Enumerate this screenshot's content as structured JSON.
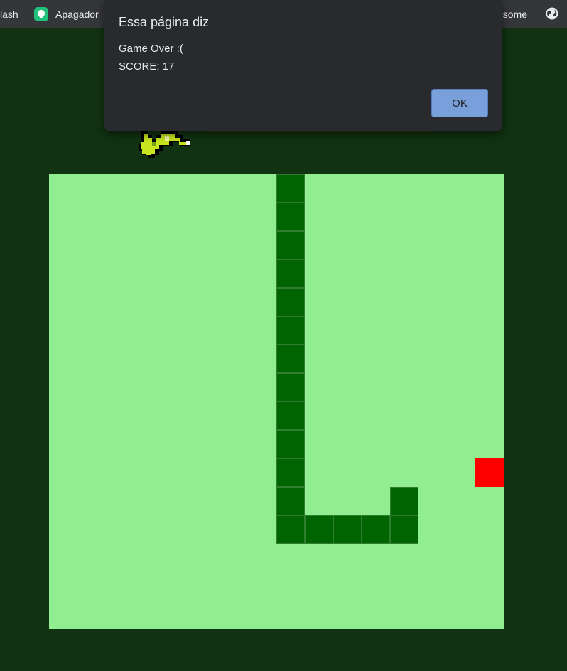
{
  "bookmarks": [
    {
      "label": "lash",
      "icon": "bookmark-icon"
    },
    {
      "label": "Apagador",
      "icon": "apagador-icon"
    },
    {
      "label": "esome",
      "icon": "bookmark-icon"
    },
    {
      "label": "",
      "icon": "globe-icon"
    }
  ],
  "dialog": {
    "title": "Essa página diz",
    "message_line1": "Game Over :(",
    "message_line2": "SCORE: 17",
    "ok_label": "OK"
  },
  "game": {
    "grid_columns": 16,
    "grid_rows": 16,
    "board_color": "#90ee90",
    "snake_color": "#006400",
    "food_color": "#ff0000",
    "background_color": "#113311",
    "snake": [
      [
        8,
        0
      ],
      [
        8,
        1
      ],
      [
        8,
        2
      ],
      [
        8,
        3
      ],
      [
        8,
        4
      ],
      [
        8,
        5
      ],
      [
        8,
        6
      ],
      [
        8,
        7
      ],
      [
        8,
        8
      ],
      [
        8,
        9
      ],
      [
        8,
        10
      ],
      [
        8,
        11
      ],
      [
        8,
        12
      ],
      [
        9,
        12
      ],
      [
        10,
        12
      ],
      [
        11,
        12
      ],
      [
        12,
        12
      ],
      [
        12,
        11
      ]
    ],
    "food": [
      15,
      10
    ]
  }
}
